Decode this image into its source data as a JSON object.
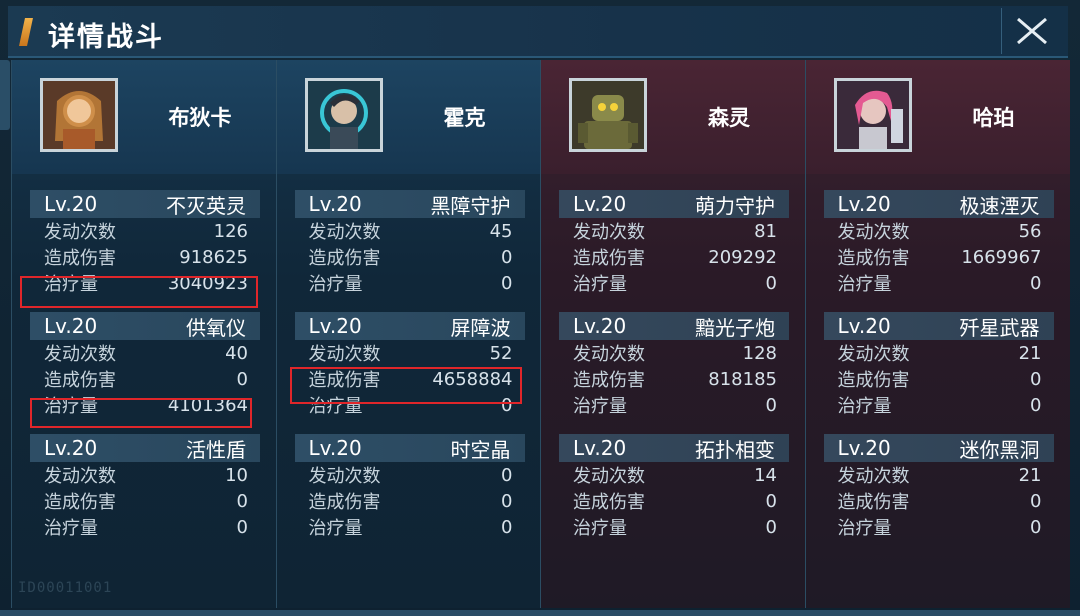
{
  "header": {
    "title": "详情战斗"
  },
  "labels": {
    "casts": "发动次数",
    "damage": "造成伤害",
    "heal": "治疗量"
  },
  "colors": {
    "allied": "#16354d",
    "enemy": "#3b2230",
    "highlight": "#e0262a"
  },
  "heroes": [
    {
      "name": "布狄卡",
      "side": "allied",
      "avatar_icon": "hero-budika-portrait",
      "skills": [
        {
          "level": "Lv.20",
          "name": "不灭英灵",
          "casts": "126",
          "damage": "918625",
          "heal": "3040923"
        },
        {
          "level": "Lv.20",
          "name": "供氧仪",
          "casts": "40",
          "damage": "0",
          "heal": "4101364"
        },
        {
          "level": "Lv.20",
          "name": "活性盾",
          "casts": "10",
          "damage": "0",
          "heal": "0"
        }
      ]
    },
    {
      "name": "霍克",
      "side": "allied",
      "avatar_icon": "hero-huoke-portrait",
      "skills": [
        {
          "level": "Lv.20",
          "name": "黑障守护",
          "casts": "45",
          "damage": "0",
          "heal": "0"
        },
        {
          "level": "Lv.20",
          "name": "屏障波",
          "casts": "52",
          "damage": "4658884",
          "heal": "0"
        },
        {
          "level": "Lv.20",
          "name": "时空晶",
          "casts": "0",
          "damage": "0",
          "heal": "0"
        }
      ]
    },
    {
      "name": "森灵",
      "side": "enemy",
      "avatar_icon": "hero-senling-portrait",
      "skills": [
        {
          "level": "Lv.20",
          "name": "萌力守护",
          "casts": "81",
          "damage": "209292",
          "heal": "0"
        },
        {
          "level": "Lv.20",
          "name": "黯光子炮",
          "casts": "128",
          "damage": "818185",
          "heal": "0"
        },
        {
          "level": "Lv.20",
          "name": "拓扑相变",
          "casts": "14",
          "damage": "0",
          "heal": "0"
        }
      ]
    },
    {
      "name": "哈珀",
      "side": "enemy",
      "avatar_icon": "hero-haipo-portrait",
      "skills": [
        {
          "level": "Lv.20",
          "name": "极速湮灭",
          "casts": "56",
          "damage": "1669967",
          "heal": "0"
        },
        {
          "level": "Lv.20",
          "name": "歼星武器",
          "casts": "21",
          "damage": "0",
          "heal": "0"
        },
        {
          "level": "Lv.20",
          "name": "迷你黑洞",
          "casts": "21",
          "damage": "0",
          "heal": "0"
        }
      ]
    }
  ],
  "watermark": "ID00011001"
}
